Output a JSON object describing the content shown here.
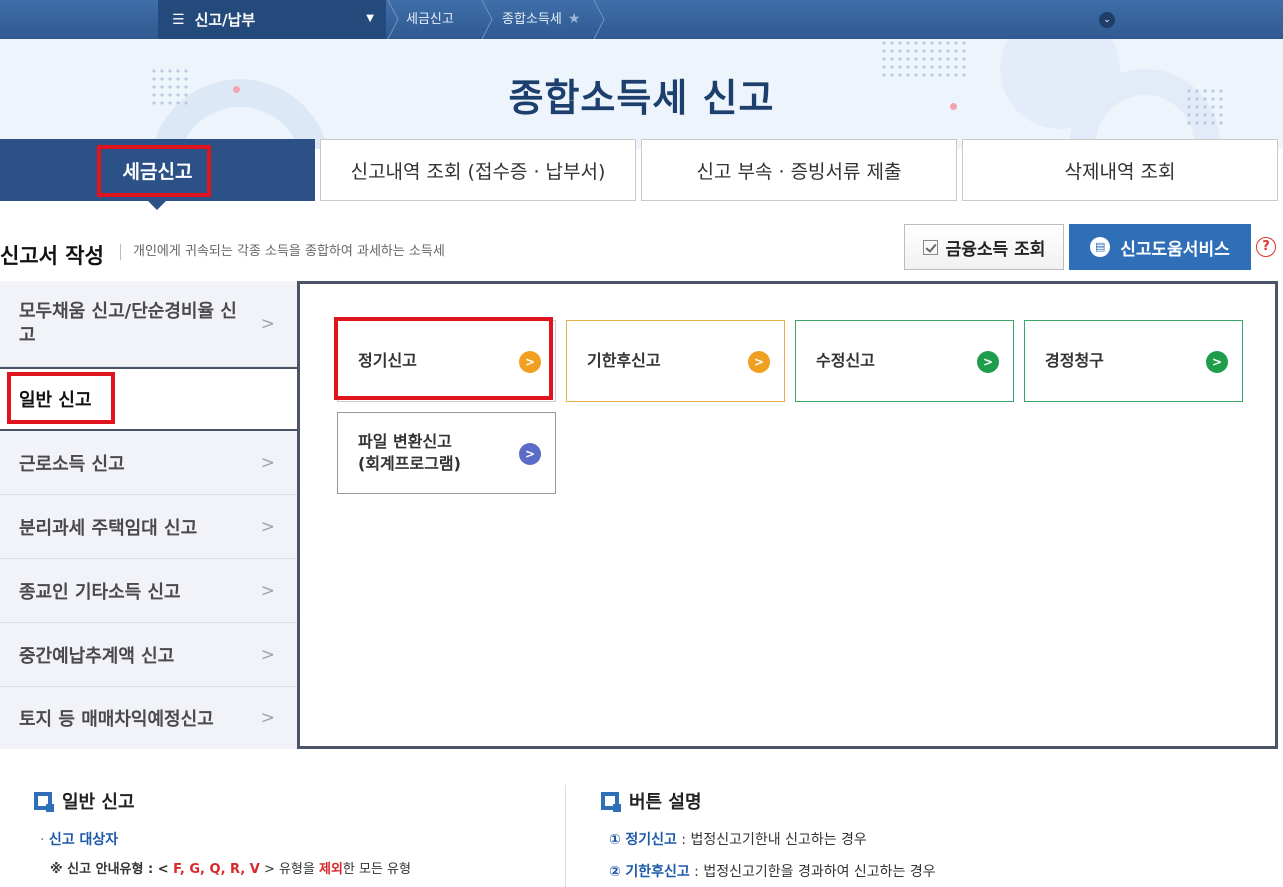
{
  "breadcrumb": {
    "menu": "신고/납부",
    "items": [
      "세금신고",
      "종합소득세"
    ]
  },
  "hero": {
    "title": "종합소득세 신고"
  },
  "tabs": [
    {
      "label": "세금신고",
      "active": true
    },
    {
      "label": "신고내역 조회 (접수증 · 납부서)",
      "active": false
    },
    {
      "label": "신고 부속 · 증빙서류 제출",
      "active": false
    },
    {
      "label": "삭제내역 조회",
      "active": false
    }
  ],
  "section": {
    "title": "신고서 작성",
    "desc": "개인에게 귀속되는 각종 소득을 종합하여 과세하는 소득세",
    "btn_financial": "금융소득 조회",
    "btn_help": "신고도움서비스",
    "help_mark": "?"
  },
  "sidebar": [
    {
      "label": "모두채움 신고/단순경비율 신고"
    },
    {
      "label": "일반 신고",
      "active": true
    },
    {
      "label": "근로소득 신고"
    },
    {
      "label": "분리과세 주택임대 신고"
    },
    {
      "label": "종교인 기타소득 신고"
    },
    {
      "label": "중간예납추계액 신고"
    },
    {
      "label": "토지 등 매매차익예정신고"
    }
  ],
  "cards": [
    {
      "label": "정기신고",
      "icon_color": "#f0a020"
    },
    {
      "label": "기한후신고",
      "icon_color": "#f0a020"
    },
    {
      "label": "수정신고",
      "icon_color": "#1e9e4a"
    },
    {
      "label": "경정청구",
      "icon_color": "#1e9e4a"
    },
    {
      "label": "파일 변환신고\n(회계프로그램)",
      "icon_color": "#5b6cc8"
    }
  ],
  "info_left": {
    "heading": "일반 신고",
    "target_label": "신고 대상자",
    "note_prefix": "※ 신고 안내유형 : < ",
    "note_codes": "F, G, Q, R, V",
    "note_mid": " > 유형을 ",
    "note_exclude": "제외",
    "note_suffix": "한 모든 유형"
  },
  "info_right": {
    "heading": "버튼 설명",
    "lines": [
      {
        "num": "①",
        "term": "정기신고",
        "desc": " : 법정신고기한내 신고하는 경우"
      },
      {
        "num": "②",
        "term": "기한후신고",
        "desc": " : 법정신고기한을 경과하여 신고하는 경우"
      }
    ]
  }
}
